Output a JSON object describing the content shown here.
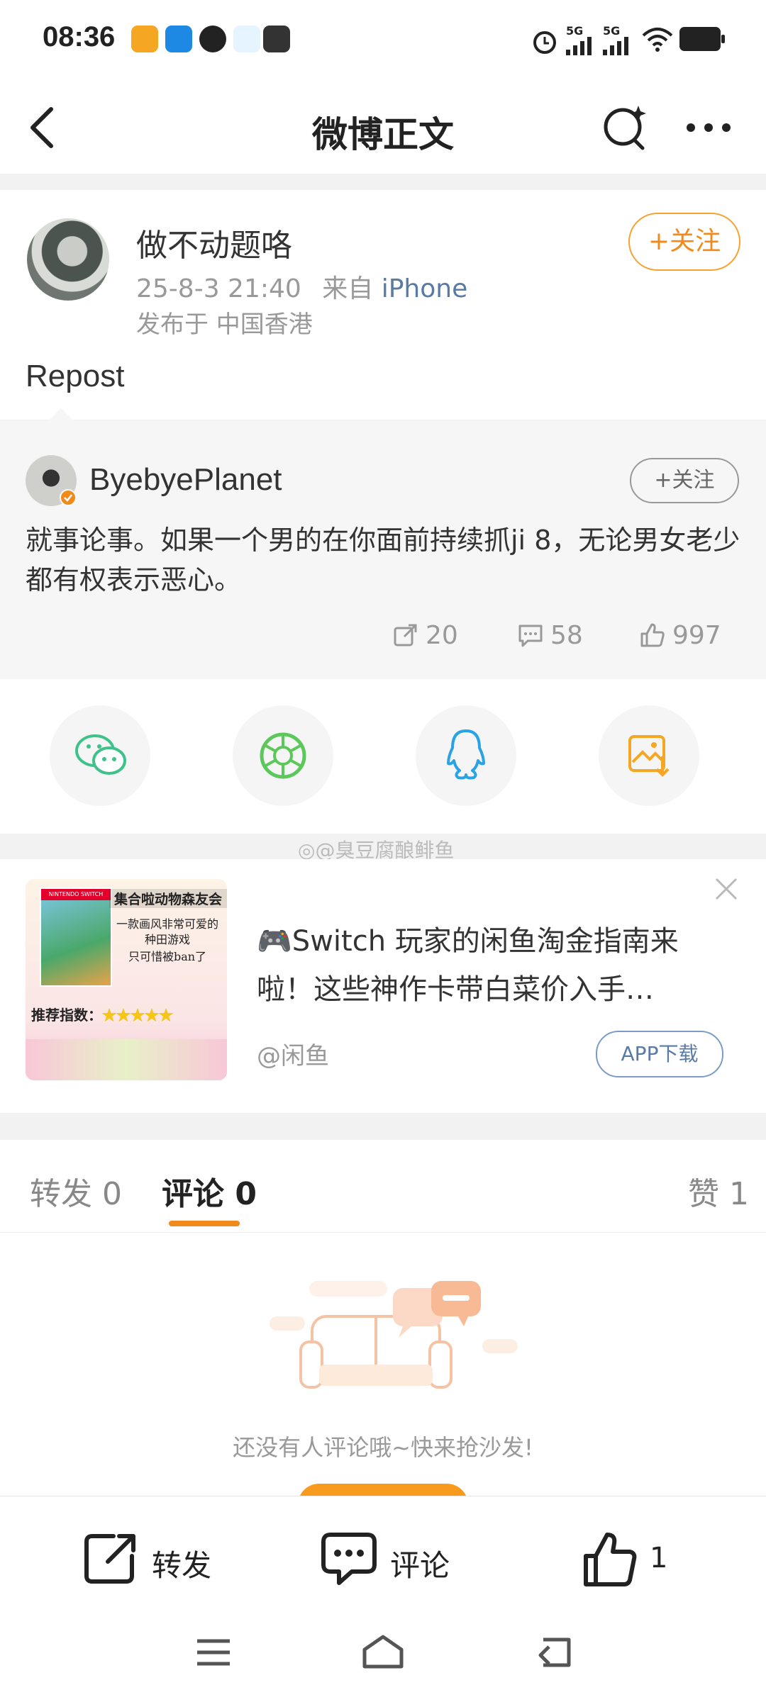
{
  "status_bar": {
    "time": "08:36",
    "net1": "5G",
    "net2": "5G"
  },
  "header": {
    "title": "微博正文"
  },
  "post": {
    "author": "做不动题咯",
    "datetime": "25-8-3 21:40",
    "source_prefix": "来自",
    "source": "iPhone",
    "location": "发布于 中国香港",
    "follow_label": "+关注",
    "text": "Repost"
  },
  "repost": {
    "author": "ByebyePlanet",
    "follow_label": "+关注",
    "text": "就事论事。如果一个男的在你面前持续抓ji 8，无论男女老少都有权表示恶心。",
    "reposts": "20",
    "comments": "58",
    "likes": "997"
  },
  "share": [
    "wechat-icon",
    "moments-icon",
    "qq-icon",
    "save-image-icon"
  ],
  "watermark": "@臭豆腐酿鲱鱼",
  "ad": {
    "image_title": "集合啦动物森友会",
    "image_line1": "一款画风非常可爱的",
    "image_line2": "种田游戏",
    "image_line3": "只可惜被ban了",
    "image_rating": "推荐指数：",
    "image_badge": "NINTENDO SWITCH",
    "headline": "🎮Switch 玩家的闲鱼淘金指南来啦！这些神作卡带白菜价入手…",
    "source": "@闲鱼",
    "cta": "APP下载"
  },
  "tabs": {
    "repost": "转发 0",
    "comment": "评论 0",
    "like": "赞 1"
  },
  "empty": {
    "text": "还没有人评论哦~快来抢沙发!"
  },
  "bottom": {
    "repost": "转发",
    "comment": "评论",
    "like_count": "1"
  },
  "colors": {
    "accent": "#f28a1b",
    "link": "#5a7aa6"
  }
}
